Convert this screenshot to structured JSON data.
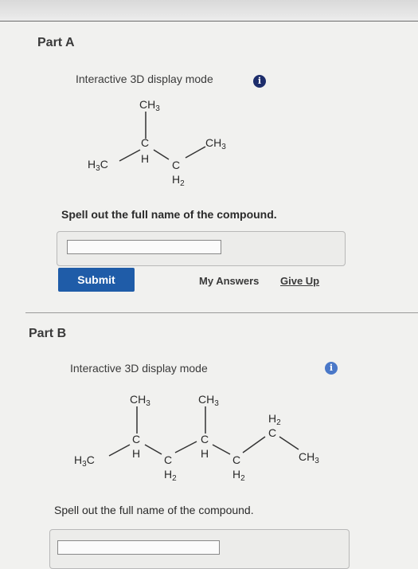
{
  "partA": {
    "title": "Part A",
    "display_mode": "Interactive 3D display mode",
    "info_icon": "i",
    "prompt": "Spell out the full name of the compound.",
    "answer_value": "",
    "submit_label": "Submit",
    "my_answers_label": "My Answers",
    "give_up_label": "Give Up",
    "molecule": {
      "top_group": "CH3",
      "center_atom": "C",
      "center_h": "H",
      "left_group": "H3C",
      "right_atom": "C",
      "right_h2": "H2",
      "end_group": "CH3"
    }
  },
  "partB": {
    "title": "Part B",
    "display_mode": "Interactive 3D display mode",
    "info_icon": "i",
    "prompt": "Spell out the full name of the compound.",
    "answer_value": "",
    "molecule": {
      "left_group": "H3C",
      "ch_atom": "C",
      "h_label": "H",
      "methyl": "CH3",
      "ch2_atom": "C",
      "h2_label": "H2",
      "end_group": "CH3"
    }
  },
  "colors": {
    "submit_bg": "#1f5ca8",
    "info_a": "#1d2d6b",
    "info_b": "#4a78c8"
  }
}
